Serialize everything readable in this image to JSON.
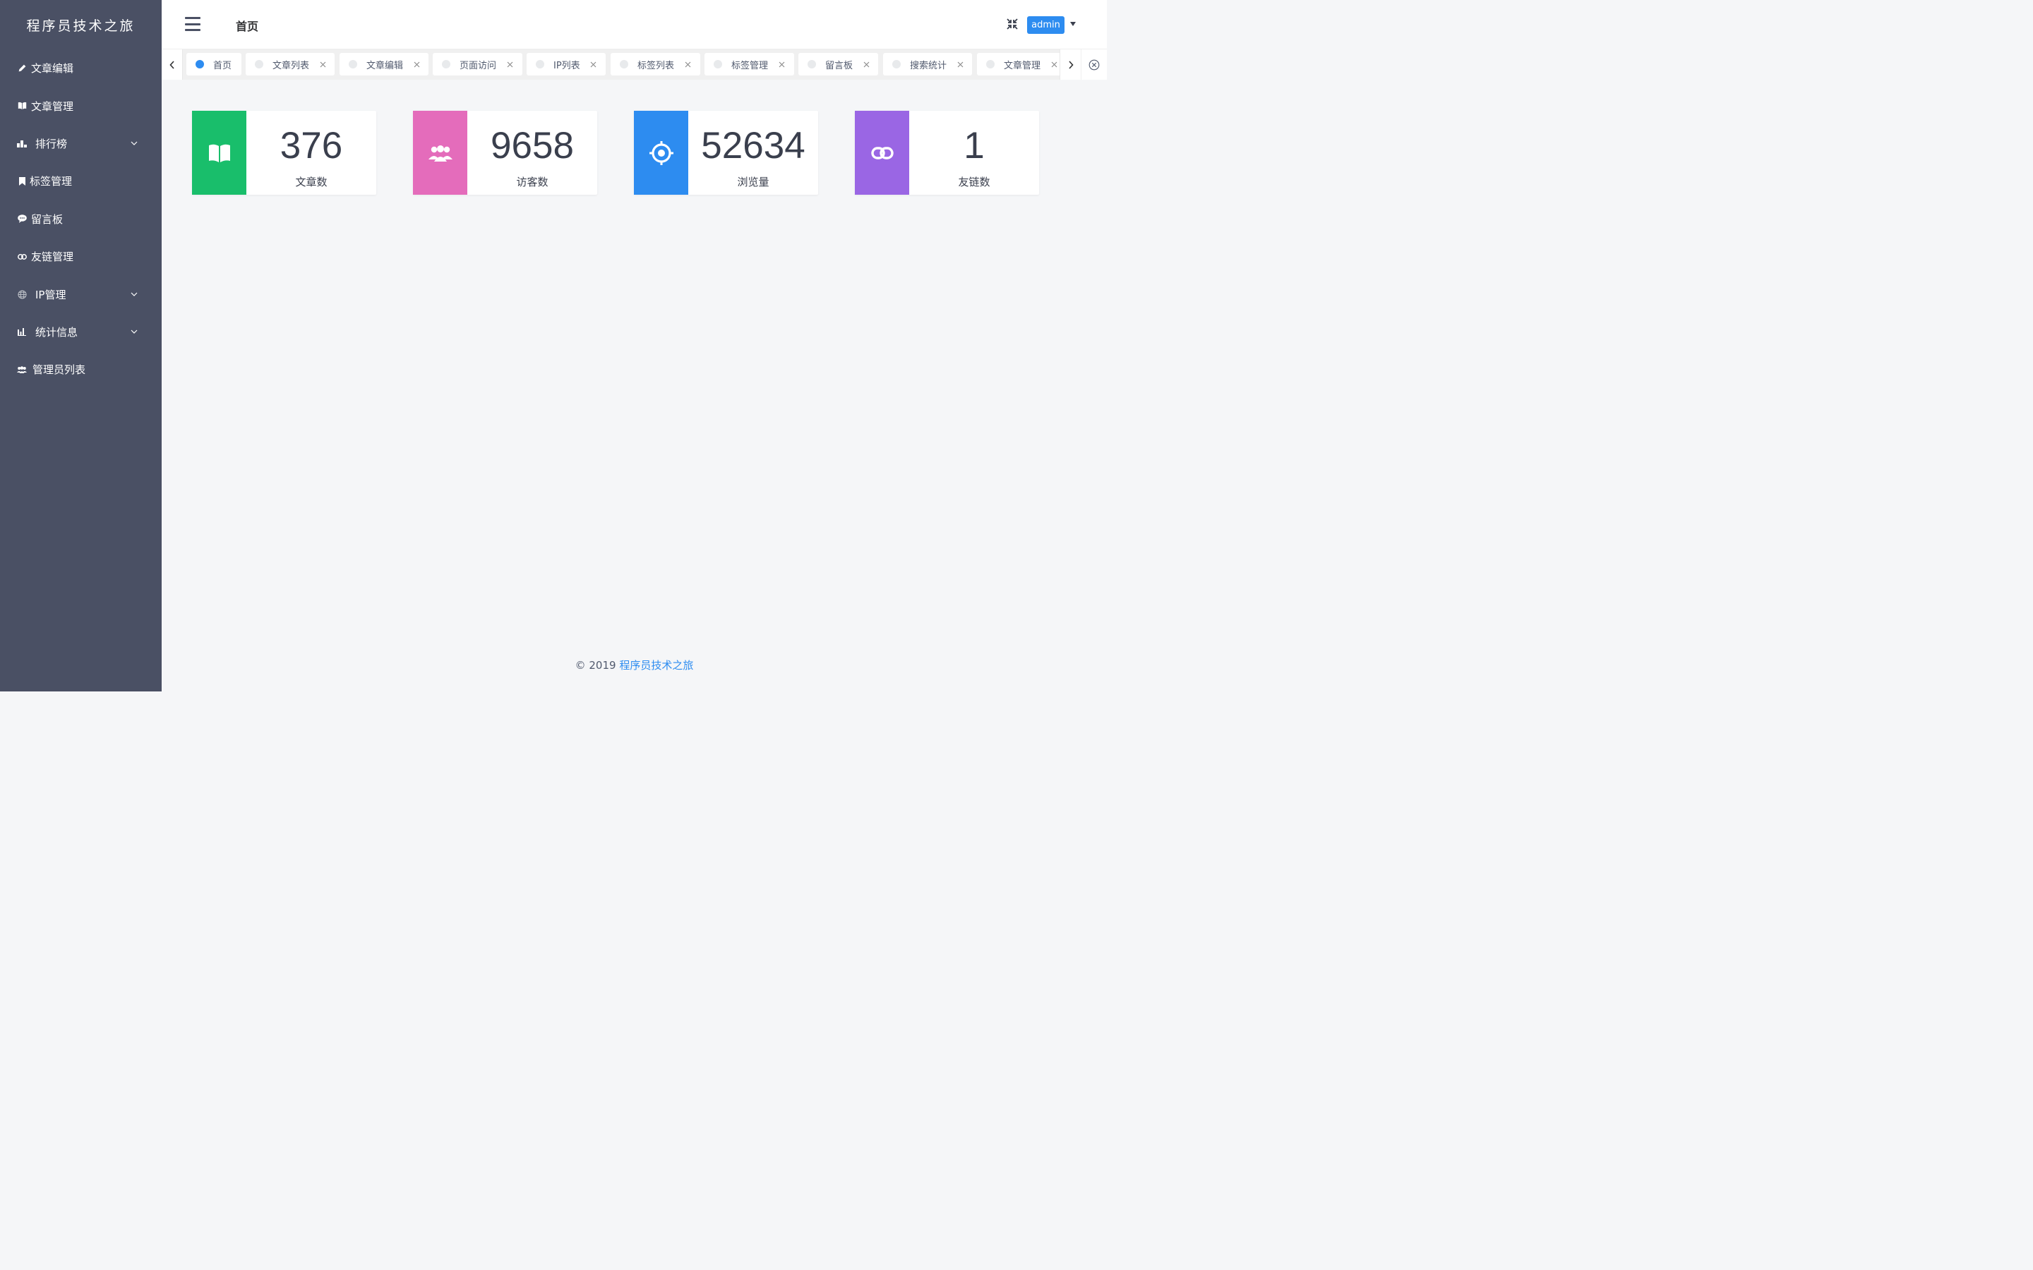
{
  "sidebar": {
    "logo": "程序员技术之旅",
    "items": [
      {
        "label": "文章编辑",
        "icon": "pencil-icon"
      },
      {
        "label": "文章管理",
        "icon": "book-icon"
      },
      {
        "label": "排行榜",
        "icon": "bar-chart-icon",
        "expandable": true
      },
      {
        "label": "标签管理",
        "icon": "bookmark-icon"
      },
      {
        "label": "留言板",
        "icon": "chat-bubble-icon"
      },
      {
        "label": "友链管理",
        "icon": "link-icon"
      },
      {
        "label": "IP管理",
        "icon": "globe-icon",
        "expandable": true
      },
      {
        "label": "统计信息",
        "icon": "stats-icon",
        "expandable": true
      },
      {
        "label": "管理员列表",
        "icon": "users-icon"
      }
    ]
  },
  "header": {
    "title": "首页",
    "user": "admin"
  },
  "tabs": [
    {
      "label": "首页",
      "active": true,
      "closable": false
    },
    {
      "label": "文章列表",
      "closable": true
    },
    {
      "label": "文章编辑",
      "closable": true
    },
    {
      "label": "页面访问",
      "closable": true
    },
    {
      "label": "IP列表",
      "closable": true
    },
    {
      "label": "标签列表",
      "closable": true
    },
    {
      "label": "标签管理",
      "closable": true
    },
    {
      "label": "留言板",
      "closable": true
    },
    {
      "label": "搜索统计",
      "closable": true
    },
    {
      "label": "文章管理",
      "closable": true
    }
  ],
  "stats": [
    {
      "value": "376",
      "label": "文章数",
      "color": "#19be6b",
      "icon": "book-icon"
    },
    {
      "value": "9658",
      "label": "访客数",
      "color": "#e46cbb",
      "icon": "users-icon"
    },
    {
      "value": "52634",
      "label": "浏览量",
      "color": "#2d8cf0",
      "icon": "target-icon"
    },
    {
      "value": "1",
      "label": "友链数",
      "color": "#9a66e4",
      "icon": "link-icon"
    }
  ],
  "footer": {
    "copyright": "© 2019 ",
    "link": "程序员技术之旅"
  }
}
